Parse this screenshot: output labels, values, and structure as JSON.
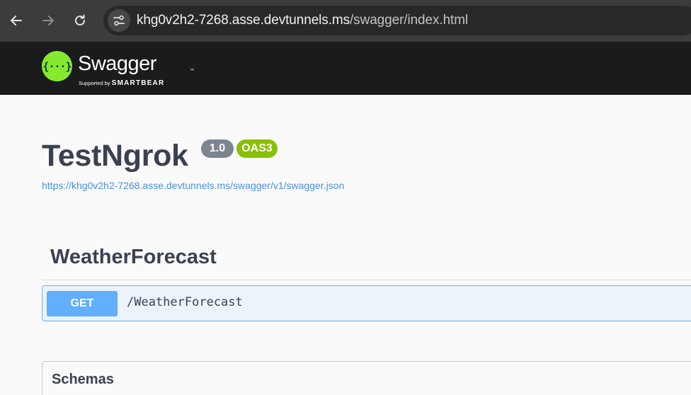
{
  "browser": {
    "url_host": "khg0v2h2-7268.asse.devtunnels.ms",
    "url_path": "/swagger/index.html"
  },
  "topbar": {
    "logo_mark": "{···}",
    "brand": "Swagger",
    "tm": "™",
    "supported_by": "Supported by",
    "smartbear": "SMARTBEAR"
  },
  "info": {
    "title": "TestNgrok",
    "version": "1.0",
    "oas": "OAS3",
    "spec_url": "https://khg0v2h2-7268.asse.devtunnels.ms/swagger/v1/swagger.json"
  },
  "tags": [
    {
      "name": "WeatherForecast",
      "operations": [
        {
          "method": "GET",
          "path": "/WeatherForecast"
        }
      ]
    }
  ],
  "schemas": {
    "label": "Schemas"
  },
  "colors": {
    "get": "#61affe",
    "oas": "#89bf04",
    "logo": "#85ea2d"
  }
}
